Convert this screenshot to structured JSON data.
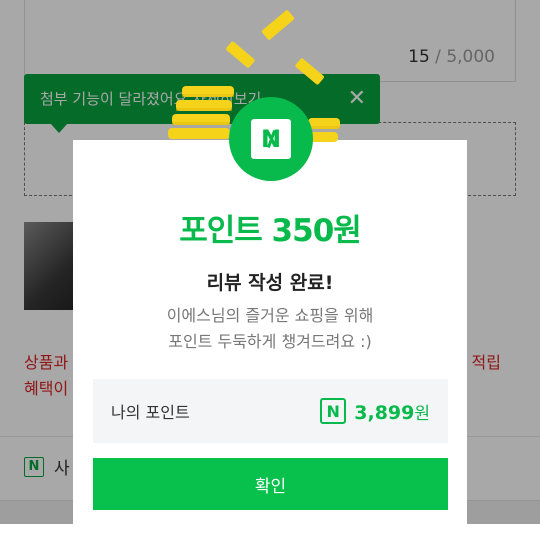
{
  "background": {
    "counter_current": "15",
    "counter_max": "5,000",
    "tooltip_text": "첨부 기능이 달라졌어요 자세히보기",
    "tooltip_close": "✕",
    "promo_left": "상품과\n혜택이",
    "promo_right": "! 적립",
    "bottom_label": "사",
    "bottom_icon": "N"
  },
  "modal": {
    "logo_letter": "N",
    "title": "포인트 350원",
    "subtitle": "리뷰 작성 완료!",
    "desc_line1": "이에스님의 즐거운 쇼핑을 위해",
    "desc_line2": "포인트 두둑하게 챙겨드려요 :)",
    "points_label": "나의 포인트",
    "points_icon": "N",
    "points_value": "3,899",
    "points_unit": "원",
    "confirm_label": "확인"
  },
  "colors": {
    "brand_green": "#08b94b",
    "tooltip_green": "#08a33f",
    "coin_yellow": "#f5d31a",
    "promo_red": "#d22222"
  }
}
